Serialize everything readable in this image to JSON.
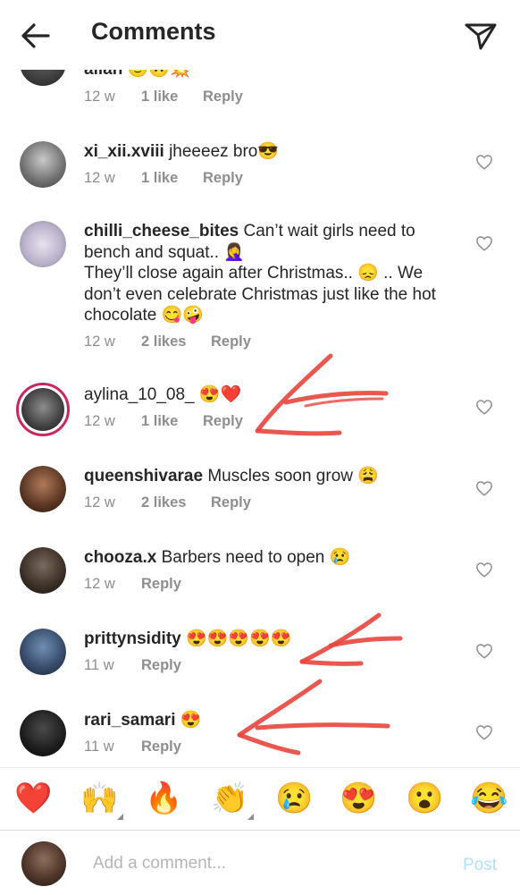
{
  "header": {
    "title": "Comments"
  },
  "comments": [
    {
      "username": "allan",
      "text": "🙂🙃💥",
      "time": "12 w",
      "likes": "1 like",
      "reply": "Reply"
    },
    {
      "username": "xi_xii.xviii",
      "text": "jheeeez bro😎",
      "time": "12 w",
      "likes": "1 like",
      "reply": "Reply"
    },
    {
      "username": "chilli_cheese_bites",
      "text": "Can’t wait girls need to bench and squat.. 🤦‍♀️\nThey’ll close again after Christmas.. 😞 .. We don’t even celebrate Christmas just like the hot chocolate 😋🤪",
      "time": "12 w",
      "likes": "2 likes",
      "reply": "Reply"
    },
    {
      "username": "aylina_10_08_",
      "text": "😍❤️",
      "time": "12 w",
      "likes": "1 like",
      "reply": "Reply"
    },
    {
      "username": "queenshivarae",
      "text": "Muscles soon grow 😩",
      "time": "12 w",
      "likes": "2 likes",
      "reply": "Reply"
    },
    {
      "username": "chooza.x",
      "text": "Barbers need to open 😢",
      "time": "12 w",
      "likes": "",
      "reply": "Reply"
    },
    {
      "username": "prittynsidity",
      "text": "😍😍😍😍😍",
      "time": "11 w",
      "likes": "",
      "reply": "Reply"
    },
    {
      "username": "rari_samari",
      "text": "😍",
      "time": "11 w",
      "likes": "",
      "reply": "Reply"
    }
  ],
  "emoji_bar": [
    "❤️",
    "🙌",
    "🔥",
    "👏",
    "😢",
    "😍",
    "😮",
    "😂"
  ],
  "composer": {
    "placeholder": "Add a comment...",
    "post_label": "Post"
  },
  "colors": {
    "annotation_arrow": "#e8453c",
    "story_ring": "#c8285e",
    "post_disabled": "#b2dffc",
    "meta_grey": "#8e8e8e"
  }
}
